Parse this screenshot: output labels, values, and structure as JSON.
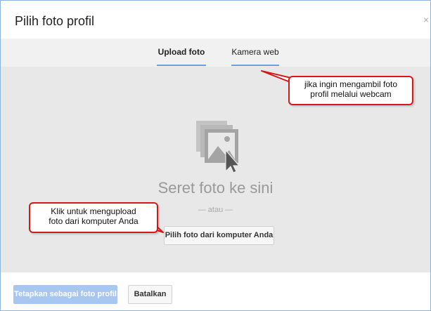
{
  "dialog": {
    "title": "Pilih foto profil",
    "close_label": "×"
  },
  "tabs": [
    {
      "label": "Upload foto",
      "active": true
    },
    {
      "label": "Kamera web",
      "active": false
    }
  ],
  "drop_area": {
    "icon": "photo-drop-icon",
    "text": "Seret foto ke sini",
    "or_text": "— atau —",
    "choose_button_label": "Pilih foto dari komputer Anda"
  },
  "footer": {
    "set_profile_label": "Tetapkan sebagai foto profil",
    "cancel_label": "Batalkan"
  },
  "annotations": {
    "webcam_line1": "jika ingin mengambil foto",
    "webcam_line2": "profil melalui webcam",
    "upload_line1": "Klik untuk mengupload",
    "upload_line2": "foto dari komputer Anda"
  },
  "colors": {
    "accent": "#6aa0e0",
    "primary_button_disabled": "#a8c7f0",
    "callout_border": "#d21a1a",
    "drop_background": "#e8e8e8"
  }
}
